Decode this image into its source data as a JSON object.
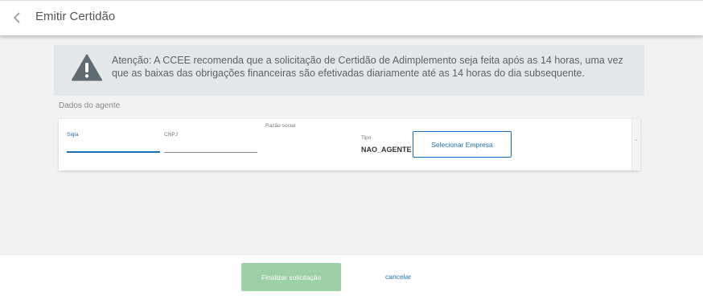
{
  "header": {
    "title": "Emitir Certidão",
    "back_icon": "chevron-left-icon"
  },
  "alert": {
    "icon": "warning-icon",
    "text": "Atenção: A CCEE recomenda que a solicitação de Certidão de Adimplemento seja feita após as 14 horas, uma vez que as baixas das obrigações financeiras são efetivadas diariamente até as 14 horas do dia subsequente."
  },
  "agent": {
    "section_label": "Dados do agente",
    "sigla_label": "Sigla",
    "sigla_value": "",
    "cnpj_label": "CNPJ",
    "cnpj_value": "",
    "razao_label": "Razão social",
    "tipo_label": "Tipo",
    "tipo_value": "NAO_AGENTE",
    "select_button": "Selecionar Empresa"
  },
  "footer": {
    "finalize_button": "Finalizar solicitação",
    "cancel_link": "cancelar"
  },
  "colors": {
    "primary": "#1a6fb5",
    "finalize_disabled": "#9ed0a6",
    "alert_background": "#e3e7ea",
    "warning_icon": "#5f6b73"
  }
}
